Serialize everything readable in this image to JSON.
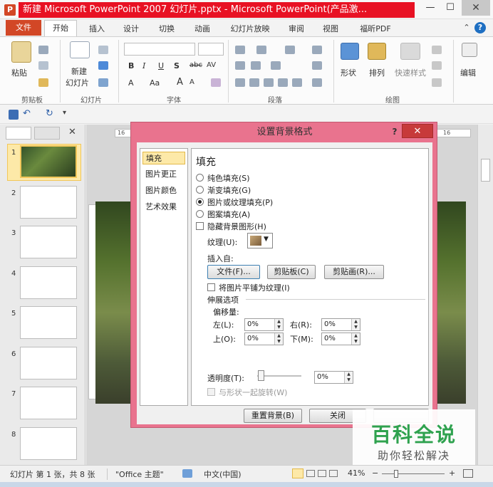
{
  "window": {
    "title": "新建 Microsoft PowerPoint 2007 幻灯片.pptx - Microsoft PowerPoint(产品激...",
    "app_icon": "P",
    "minimize": "—",
    "restore": "☐",
    "close": "✕"
  },
  "ribbon_tabs": {
    "file": "文件",
    "tabs": [
      "开始",
      "插入",
      "设计",
      "切换",
      "动画",
      "幻灯片放映",
      "审阅",
      "视图",
      "福昕PDF"
    ],
    "collapse": "⌃",
    "help": "?"
  },
  "ribbon": {
    "clipboard": {
      "paste": "粘贴",
      "label": "剪贴板"
    },
    "slides": {
      "new_slide": "新建",
      "new_slide_2": "幻灯片",
      "label": "幻灯片"
    },
    "font": {
      "label": "字体",
      "bold": "B",
      "italic": "I",
      "underline": "U",
      "strike": "S",
      "abc": "abc",
      "av": "AV",
      "font_a": "A",
      "aa": "Aa",
      "grow": "A",
      "shrink": "A"
    },
    "paragraph": {
      "label": "段落"
    },
    "drawing": {
      "shapes": "形状",
      "arrange": "排列",
      "quick_styles": "快速样式",
      "label": "绘图"
    },
    "editing": {
      "label": "编辑"
    }
  },
  "qat": {
    "undo": "↶",
    "redo": "↻",
    "more": "▾"
  },
  "slide_panel": {
    "close": "✕",
    "numbers": [
      "1",
      "2",
      "3",
      "4",
      "5",
      "6",
      "7",
      "8"
    ]
  },
  "rulers": {
    "left": "16",
    "right": "16"
  },
  "dialog": {
    "title": "设置背景格式",
    "help": "?",
    "close": "✕",
    "categories": [
      "填充",
      "图片更正",
      "图片颜色",
      "艺术效果"
    ],
    "heading": "填充",
    "options": {
      "solid": "纯色填充(S)",
      "gradient": "渐变填充(G)",
      "picture": "图片或纹理填充(P)",
      "pattern": "图案填充(A)",
      "hide_bg": "隐藏背景图形(H)"
    },
    "texture_label": "纹理(U):",
    "insert_from": "插入自:",
    "file_btn": "文件(F)...",
    "clipboard_btn": "剪贴板(C)",
    "clipart_btn": "剪贴画(R)...",
    "tile_label": "将图片平铺为纹理(I)",
    "stretch_label": "伸展选项",
    "offset_label": "偏移量:",
    "left_label": "左(L):",
    "right_label": "右(R):",
    "top_label": "上(O):",
    "bottom_label": "下(M):",
    "left_val": "0%",
    "right_val": "0%",
    "top_val": "0%",
    "bottom_val": "0%",
    "transparency_label": "透明度(T):",
    "transparency_val": "0%",
    "rotate_label": "与形状一起旋转(W)",
    "reset_btn": "重置背景(B)",
    "close_btn": "关闭"
  },
  "watermark": {
    "title": "百科全说",
    "subtitle": "助你轻松解决"
  },
  "statusbar": {
    "slide_info": "幻灯片 第 1 张，共 8 张",
    "theme": "\"Office 主题\"",
    "language": "中文(中国)",
    "zoom": "41%",
    "zoom_minus": "−",
    "zoom_plus": "+"
  }
}
